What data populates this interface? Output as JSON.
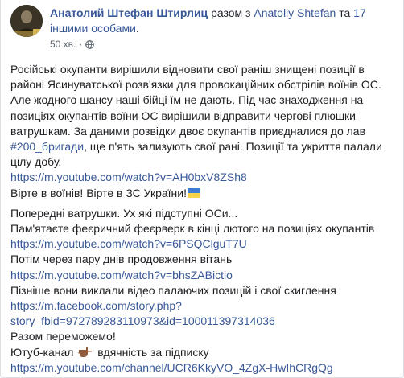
{
  "post": {
    "author": "Анатолий Штефан Штирлиц",
    "with_word": "разом з",
    "tagged": "Anatoliy Shtefan",
    "and_word": "та",
    "others": "17 іншими особами",
    "period": ".",
    "time": "50 хв.",
    "separator": "·"
  },
  "body": {
    "p1_lines": [
      "Російські окупанти вирішили відновити свої раніш знищені позиції в",
      "районі Ясинуватської розв'язки для провокаційних обстрілів воїнів ОС.",
      "Але жодного шансу наші бійці їм не дають. Під час знаходження на",
      "позиціях окупантів воїни ОС вирішили відправити чергові плюшки",
      "ватрушкам. За даними розвідки двоє окупантів приєдналися до лав"
    ],
    "hashtag": "#200_бригади",
    "p1_tail": ", ще п'ять зализують свої рані. Позиції та укриття палали",
    "p1_last": "цілу добу.",
    "link1": "https://m.youtube.com/watch?v=AH0bxV8ZSh8",
    "glory": "Вірте в воїнів! Вірте в ЗС України!",
    "p2_lines": [
      "Попередні ватрушки. Ух які підступні ОСи...",
      "Пам'ятаєте феєричний феєрверк в кінці лютого на позиціях окупантів"
    ],
    "link2": "https://m.youtube.com/watch?v=6PSQClguT7U",
    "then_line": "Потім через пару днів продовження вітань",
    "link3": "https://m.youtube.com/watch?v=bhsZABictio",
    "later_line": "Пізніше вони виклали відео палаючих позицій і свої скиглення",
    "link4_a": "https://m.facebook.com/story.php?",
    "link4_b": "story_fbid=972789283110973&id=100011397314036",
    "together": "Разом переможемо!",
    "channel_prefix": "Ютуб-канал",
    "channel_suffix": "вдячність за підписку",
    "link5": "https://m.youtube.com/channel/UCR6KkyVO_4ZgX-HwIhCRgQg"
  },
  "icons": {
    "globe": "globe-icon",
    "flag": "ukraine-flag-icon",
    "hand": "pointing-down-hand-icon"
  },
  "colors": {
    "link": "#385898",
    "text": "#1c1e21",
    "meta": "#606770"
  }
}
